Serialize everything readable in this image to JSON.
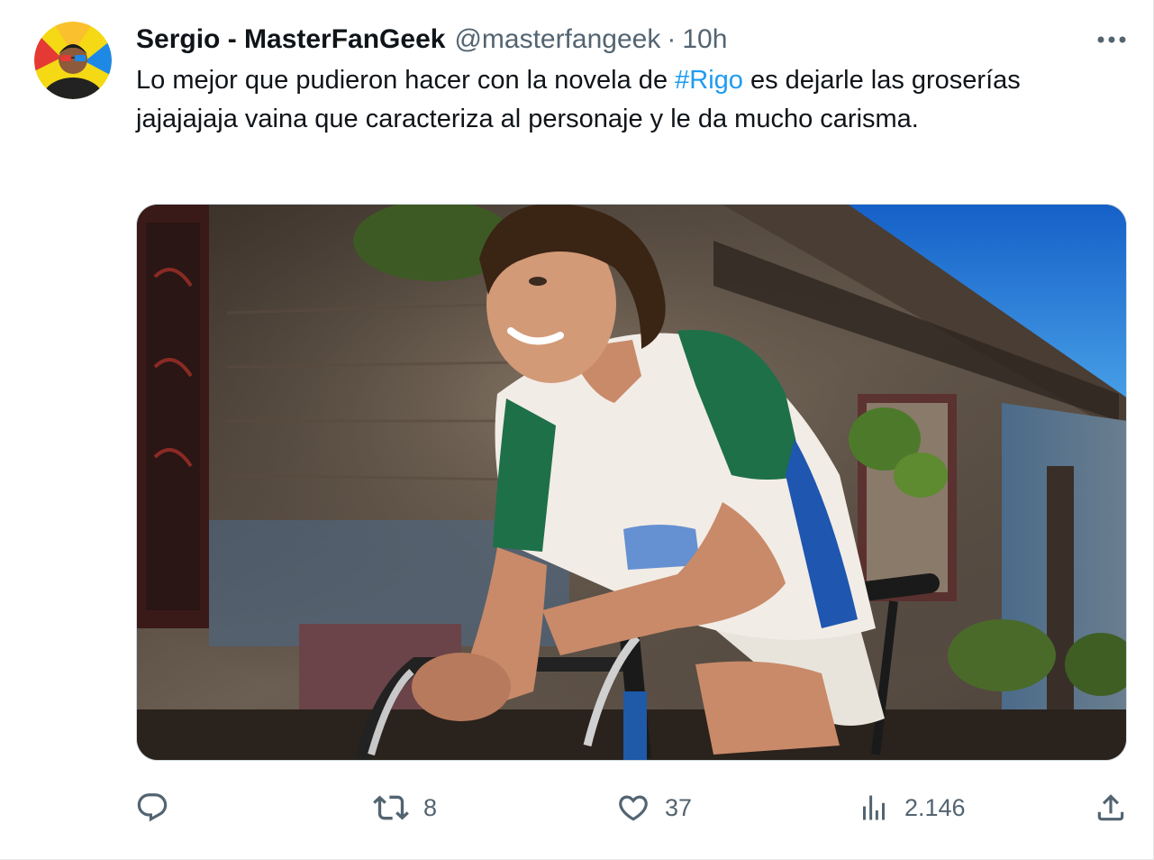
{
  "tweet": {
    "author": {
      "display_name": "Sergio - MasterFanGeek",
      "handle": "@masterfangeek",
      "avatar_icon": "avatar-glasses-icon"
    },
    "separator": "·",
    "time": "10h",
    "text": {
      "before_hashtag": "Lo mejor que pudieron hacer con la novela de ",
      "hashtag": "#Rigo",
      "after_hashtag": " es dejarle las groserías jajajajaja vaina que caracteriza al personaje y le da mucho carisma."
    },
    "media": {
      "type": "photo",
      "description_icon": "photo-cyclist"
    },
    "actions": {
      "reply": {
        "icon": "reply-icon",
        "count": ""
      },
      "retweet": {
        "icon": "retweet-icon",
        "count": "8"
      },
      "like": {
        "icon": "heart-icon",
        "count": "37"
      },
      "views": {
        "icon": "views-icon",
        "count": "2.146"
      },
      "share": {
        "icon": "share-icon"
      }
    },
    "colors": {
      "link": "#1d9bf0",
      "text": "#0f1419",
      "muted": "#536471"
    }
  }
}
